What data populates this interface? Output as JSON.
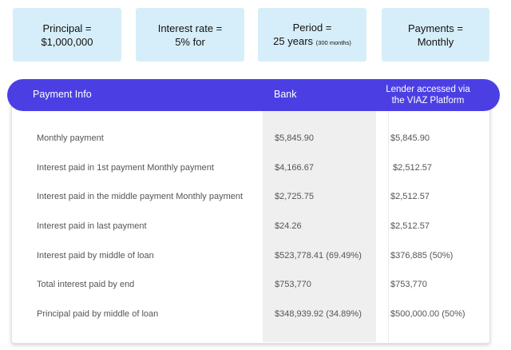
{
  "cards": {
    "principal": {
      "line1": "Principal =",
      "line2": "$1,000,000"
    },
    "rate": {
      "line1": "Interest rate =",
      "line2": "5% for"
    },
    "period": {
      "line1": "Period =",
      "line2": "25 years",
      "line2_small": "(300 months)"
    },
    "payments": {
      "line1": "Payments =",
      "line2": "Monthly"
    }
  },
  "table": {
    "headers": {
      "info": "Payment Info",
      "bank": "Bank",
      "lender_line1": "Lender accessed via",
      "lender_line2": "the VIAZ Platform"
    },
    "rows": [
      {
        "label": "Monthly payment",
        "bank": "$5,845.90",
        "lender": "$5,845.90"
      },
      {
        "label": "Interest paid in 1st payment Monthly payment",
        "bank": "$4,166.67",
        "lender": " $2,512.57"
      },
      {
        "label": "Interest paid in the middle payment Monthly payment",
        "bank": "$2,725.75",
        "lender": "$2,512.57"
      },
      {
        "label": "Interest paid in last payment",
        "bank": "$24.26",
        "lender": "$2,512.57"
      },
      {
        "label": "Interest paid by middle of loan",
        "bank": "$523,778.41 (69.49%)",
        "lender": "$376,885 (50%)"
      },
      {
        "label": "Total interest paid by end",
        "bank": "$753,770",
        "lender": "$753,770"
      },
      {
        "label": "Principal paid by middle of loan",
        "bank": "$348,939.92 (34.89%)",
        "lender": "$500,000.00 (50%)"
      }
    ]
  },
  "colors": {
    "card_bg": "#d6eef9",
    "header_bg": "#4b3fe4",
    "bank_col_bg": "#efefef"
  }
}
